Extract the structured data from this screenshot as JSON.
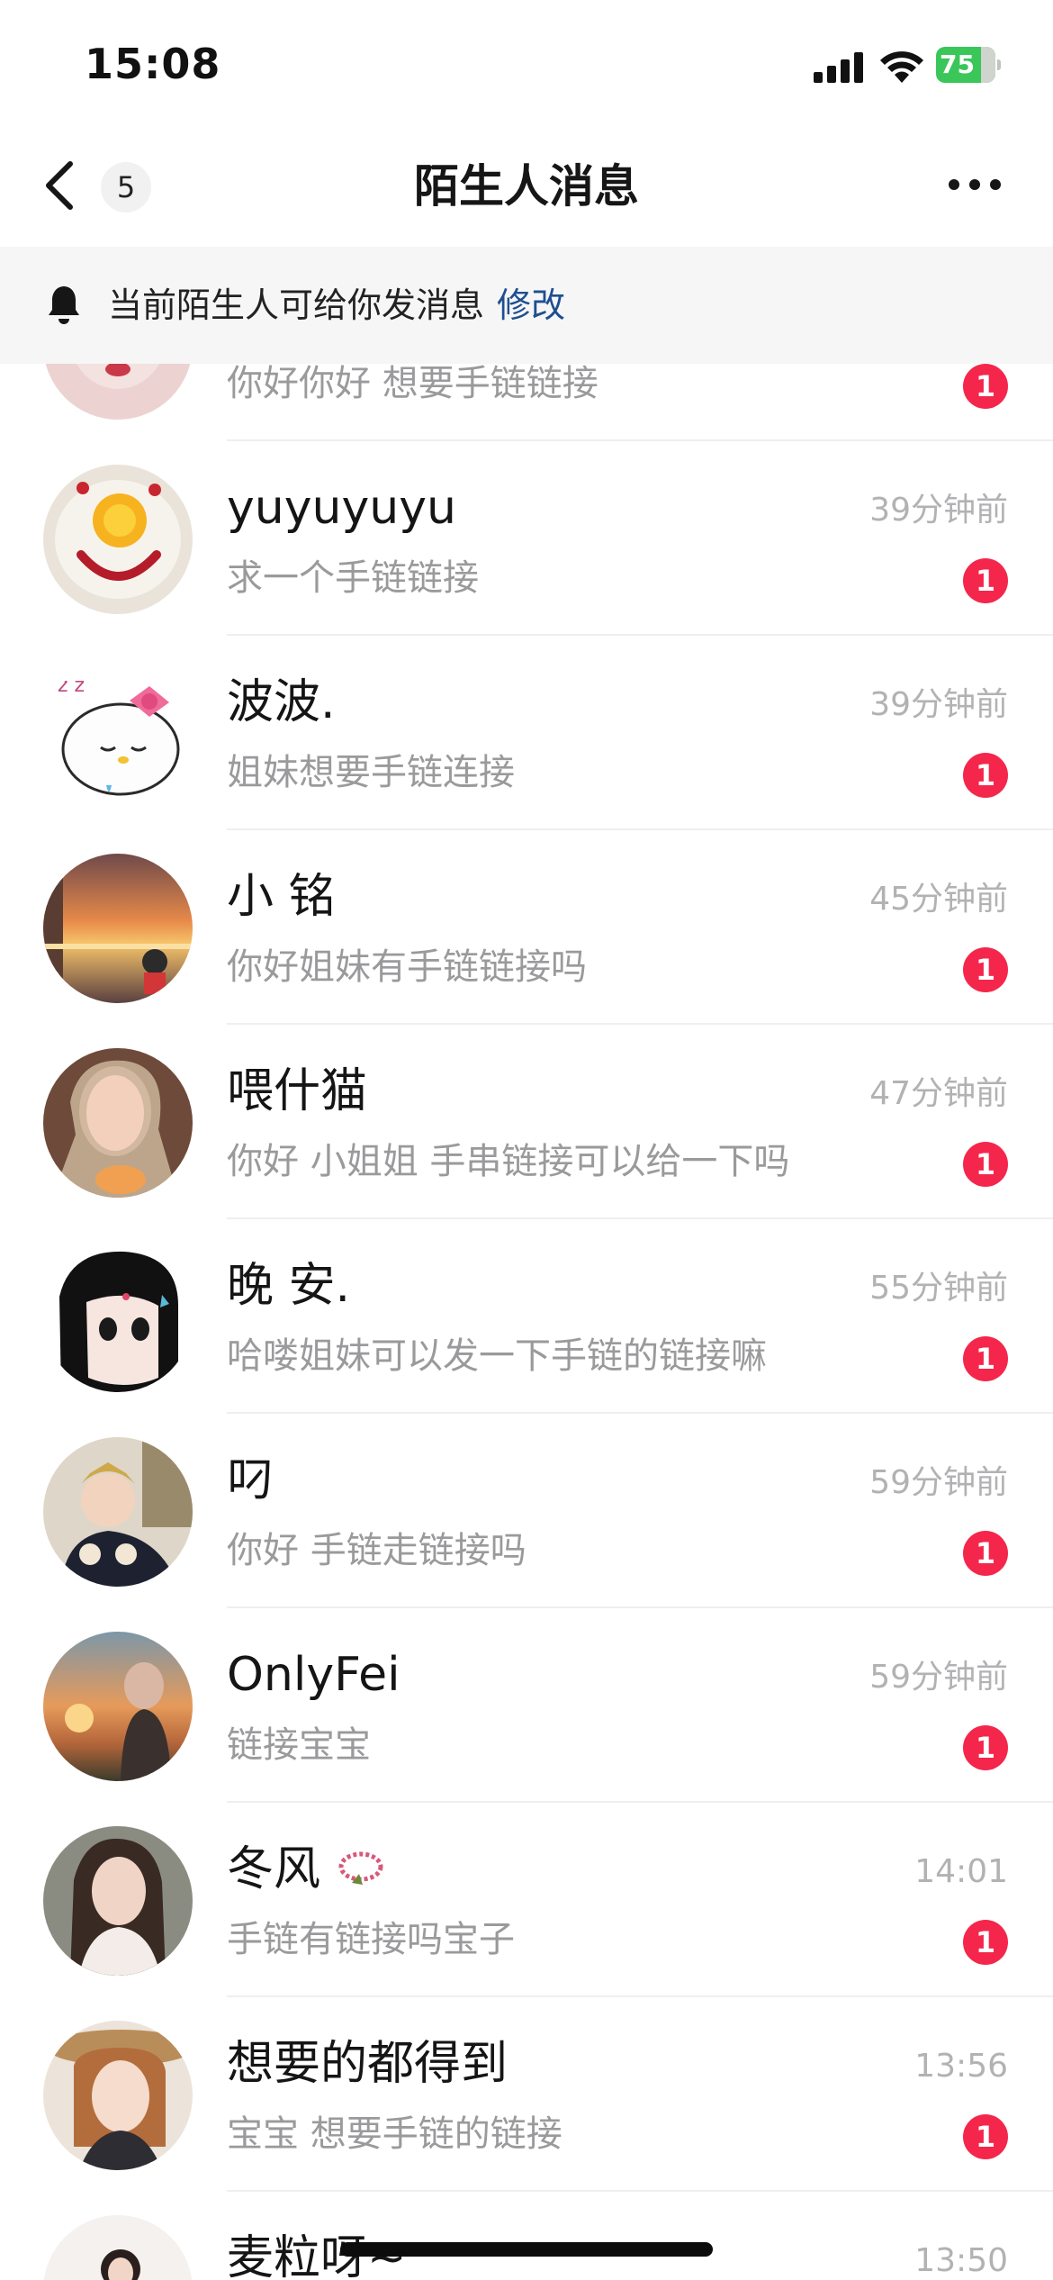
{
  "status_bar": {
    "time": "15:08",
    "battery_level": "75",
    "icons": [
      "signal-icon",
      "wifi-icon",
      "battery-charging-icon"
    ]
  },
  "nav": {
    "back_icon": "chevron-left-icon",
    "unread_count": "5",
    "title": "陌生人消息",
    "more_icon": "more-dots-icon"
  },
  "banner": {
    "icon": "bell-icon",
    "text": "当前陌生人可给你发消息",
    "link": "修改"
  },
  "colors": {
    "badge": "#f5264b",
    "link": "#1f4f8f",
    "banner_bg": "#f6f6f7",
    "muted_text": "#9a9a9c",
    "time_text": "#b2b2b4"
  },
  "messages": [
    {
      "name": "",
      "time": "",
      "preview": "你好你好 想要手链链接",
      "badge": "1"
    },
    {
      "name": "yuyuyuyu",
      "time": "39分钟前",
      "preview": "求一个手链链接",
      "badge": "1"
    },
    {
      "name": "波波.",
      "time": "39分钟前",
      "preview": "姐妹想要手链连接",
      "badge": "1"
    },
    {
      "name": "小 铭",
      "time": "45分钟前",
      "preview": "你好姐妹有手链链接吗",
      "badge": "1"
    },
    {
      "name": "喂什猫",
      "time": "47分钟前",
      "preview": "你好 小姐姐 手串链接可以给一下吗",
      "badge": "1"
    },
    {
      "name": "晚 安.",
      "time": "55分钟前",
      "preview": "哈喽姐妹可以发一下手链的链接嘛",
      "badge": "1"
    },
    {
      "name": "叼",
      "time": "59分钟前",
      "preview": "你好  手链走链接吗",
      "badge": "1"
    },
    {
      "name": "OnlyFei",
      "time": "59分钟前",
      "preview": "链接宝宝",
      "badge": "1"
    },
    {
      "name": "冬风",
      "time": "14:01",
      "preview": "手链有链接吗宝子",
      "badge": "1"
    },
    {
      "name": "想要的都得到",
      "time": "13:56",
      "preview": "宝宝 想要手链的链接",
      "badge": "1"
    },
    {
      "name": "麦粒呀~",
      "time": "13:50",
      "preview": "",
      "badge": ""
    }
  ]
}
